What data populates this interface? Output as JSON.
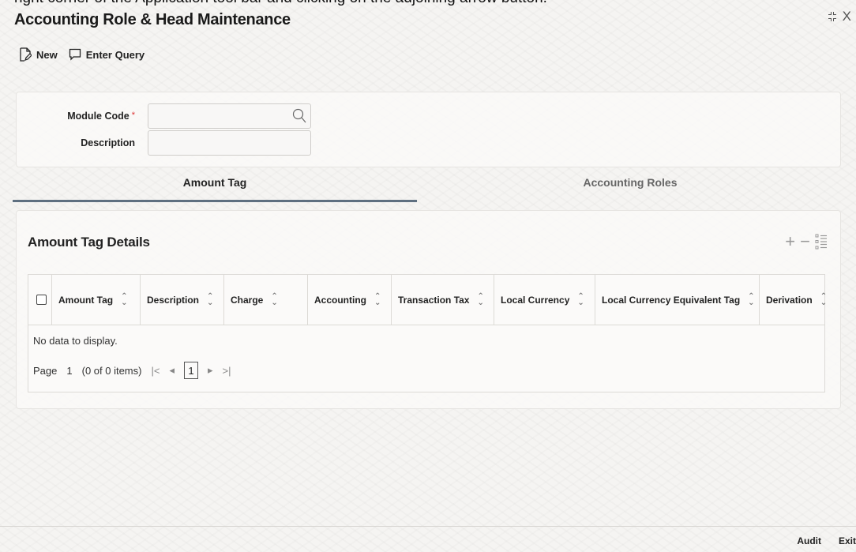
{
  "caption": "right corner of the Application tool bar and clicking on the adjoining arrow button.",
  "window": {
    "title": "Accounting Role & Head Maintenance",
    "close_label": "X"
  },
  "toolbar": {
    "new_label": "New",
    "enter_query_label": "Enter Query"
  },
  "header": {
    "module_code_label": "Module Code",
    "module_code_value": "",
    "description_label": "Description",
    "description_value": ""
  },
  "tabs": [
    {
      "label": "Amount Tag",
      "active": true
    },
    {
      "label": "Accounting Roles",
      "active": false
    }
  ],
  "details": {
    "title": "Amount Tag Details",
    "columns": [
      "Amount Tag",
      "Description",
      "Charge",
      "Accounting",
      "Transaction Tax",
      "Local Currency",
      "Local Currency Equivalent Tag",
      "Derivation"
    ],
    "rows": [],
    "empty_message": "No data to display.",
    "pager": {
      "page_label": "Page",
      "page_number": "1",
      "items_text": "(0 of 0 items)",
      "current_page": "1"
    }
  },
  "footer": {
    "audit_label": "Audit",
    "exit_label": "Exit"
  }
}
